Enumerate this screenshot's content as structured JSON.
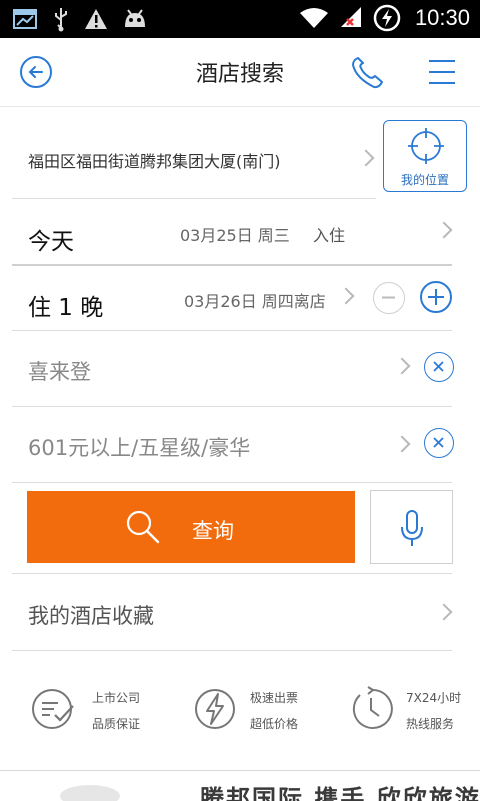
{
  "status_bar": {
    "time": "10:30"
  },
  "header": {
    "title": "酒店搜索"
  },
  "location": {
    "address": "福田区福田街道腾邦集团大厦(南门)",
    "my_location_label": "我的位置"
  },
  "checkin": {
    "day_label": "今天",
    "date": "03月25日 周三",
    "action": "入住"
  },
  "stay": {
    "nights_label": "住 1 晚",
    "checkout_date": "03月26日 周四离店"
  },
  "filters": {
    "brand": "喜来登",
    "price_star": "601元以上/五星级/豪华"
  },
  "search": {
    "label": "查询"
  },
  "favorites": {
    "label": "我的酒店收藏"
  },
  "features": [
    {
      "line1": "上市公司",
      "line2": "品质保证",
      "icon": "checklist-icon"
    },
    {
      "line1": "极速出票",
      "line2": "超低价格",
      "icon": "lightning-icon"
    },
    {
      "line1": "7X24小时",
      "line2": "热线服务",
      "icon": "clock-icon"
    }
  ],
  "banner": {
    "text": "腾邦国际 携手 欣欣旅游"
  },
  "colors": {
    "accent": "#2a7ad5",
    "search_button": "#f26c0d"
  }
}
